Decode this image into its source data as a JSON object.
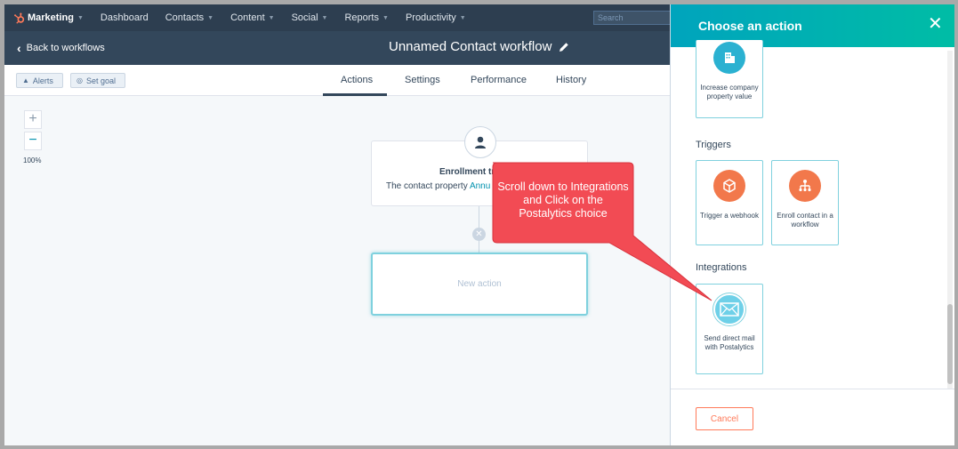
{
  "topnav": {
    "brand": "Marketing",
    "items": [
      {
        "label": "Dashboard",
        "caret": false
      },
      {
        "label": "Contacts",
        "caret": true
      },
      {
        "label": "Content",
        "caret": true
      },
      {
        "label": "Social",
        "caret": true
      },
      {
        "label": "Reports",
        "caret": true
      },
      {
        "label": "Productivity",
        "caret": true
      }
    ],
    "search_placeholder": "Search"
  },
  "workflow_bar": {
    "back_label": "Back to workflows",
    "title": "Unnamed Contact workflow"
  },
  "toolbar": {
    "alerts_label": "Alerts",
    "set_goal_label": "Set goal",
    "tabs": [
      "Actions",
      "Settings",
      "Performance",
      "History"
    ],
    "active_tab": "Actions"
  },
  "canvas": {
    "zoom_in": "+",
    "zoom_out": "−",
    "zoom_level": "100%",
    "enrollment_title": "Enrollment tr",
    "enrollment_desc_prefix": "The contact property ",
    "enrollment_desc_link": "Annu",
    "new_action_label": "New action"
  },
  "annotation": {
    "text": "Scroll down to Integrations and Click on the Postalytics choice",
    "color": "#f24b54"
  },
  "panel": {
    "title": "Choose an action",
    "close_icon": "close-icon",
    "sections": {
      "top_tile_label": "Increase company property value",
      "triggers_label": "Triggers",
      "trigger_webhook_label": "Trigger a webhook",
      "enroll_workflow_label": "Enroll contact in a workflow",
      "integrations_label": "Integrations",
      "postalytics_label": "Send direct mail with Postalytics"
    },
    "cancel_label": "Cancel",
    "accent": "#00a4bd",
    "cancel_color": "#ff7a59"
  }
}
